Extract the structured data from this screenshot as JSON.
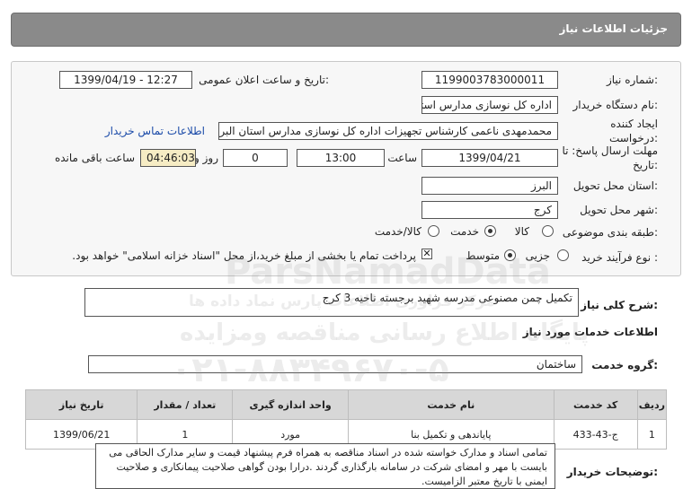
{
  "header": {
    "title": "جزئیات اطلاعات نیاز"
  },
  "form": {
    "need_number_label": "شماره نیاز:",
    "need_number": "1199003783000011",
    "announce_label": "تاریخ و ساعت اعلان عمومی:",
    "announce_value": "1399/04/19 - 12:27",
    "buyer_label": "نام دستگاه خریدار:",
    "buyer_value": "اداره کل نوسازی مدارس استان البرز",
    "creator_label": "ایجاد کننده درخواست:",
    "creator_value": "محمدمهدی ناعمی کارشناس تجهیزات اداره کل نوسازی مدارس استان البرز",
    "contact_link": "اطلاعات تماس خریدار",
    "deadline_label": "مهلت ارسال پاسخ: تا تاریخ:",
    "deadline_date": "1399/04/21",
    "time_label": "ساعت",
    "deadline_time": "13:00",
    "days_value": "0",
    "days_label": "روز و",
    "remaining_value": "04:46:03",
    "remaining_label": "ساعت باقی مانده",
    "province_label": "استان محل تحویل:",
    "province_value": "البرز",
    "city_label": "شهر محل تحویل:",
    "city_value": "کرج",
    "category_label": "طبقه بندی موضوعی:",
    "category_options": [
      "کالا",
      "خدمت",
      "کالا/خدمت"
    ],
    "process_label": "نوع فرآیند خرید :",
    "process_options": [
      "جزیی",
      "متوسط"
    ],
    "payment_note": "پرداخت تمام یا بخشی از مبلغ خرید،از محل \"اسناد خزانه اسلامی\" خواهد بود."
  },
  "need_summary": {
    "label": "شرح کلی نیاز:",
    "value": "تکمیل چمن مصنوعی مدرسه شهید برجسته ناحیه 3 کرج"
  },
  "services_title": "اطلاعات خدمات مورد نیاز",
  "service_group": {
    "label": "گروه خدمت:",
    "value": "ساختمان"
  },
  "table": {
    "headers": [
      "ردیف",
      "کد خدمت",
      "نام خدمت",
      "واحد اندازه گیری",
      "تعداد / مقدار",
      "تاریخ نیاز"
    ],
    "rows": [
      [
        "1",
        "ج-43-433",
        "پایاندهی و تکمیل بنا",
        "مورد",
        "1",
        "1399/06/21"
      ]
    ]
  },
  "buyer_notes": {
    "label": "توضیحات خریدار:",
    "value": "تمامی اسناد و مدارک خواسته شده در اسناد مناقصه به همراه فرم پیشنهاد قیمت و سایر مدارک الحاقی می بایست با مهر و امضای شرکت در سامانه بارگذاری گردند .درارا بودن گواهی صلاحیت پیمانکاری و صلاحیت ایمنی با تاریخ معتبر الزامیست."
  },
  "watermark": {
    "line1": "ParsNamadData",
    "line2": "مرکز فراوری اطلاعات پارس نماد داده ها",
    "line3": "پایگاه اطلاع رسانی مناقصه ومزایده",
    "line4": "۰۲۱-۸۸۳۴۹۶۷۰-۵"
  }
}
